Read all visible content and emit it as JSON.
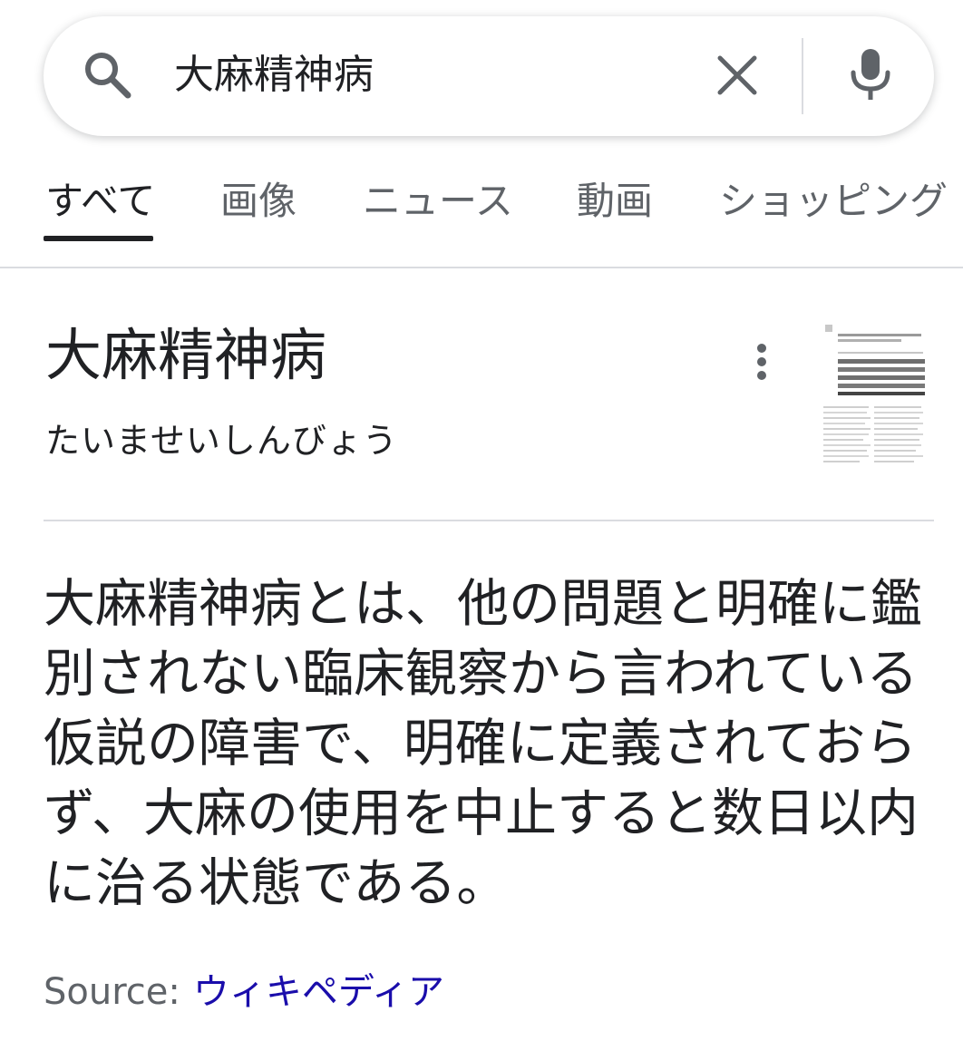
{
  "search": {
    "query": "大麻精神病",
    "search_icon": "search-icon",
    "clear_icon": "close-icon",
    "mic_icon": "microphone-icon"
  },
  "tabs": [
    {
      "label": "すべて",
      "active": true
    },
    {
      "label": "画像",
      "active": false
    },
    {
      "label": "ニュース",
      "active": false
    },
    {
      "label": "動画",
      "active": false
    },
    {
      "label": "ショッピング",
      "active": false
    }
  ],
  "knowledge_panel": {
    "title": "大麻精神病",
    "reading": "たいませいしんびょう",
    "more_icon": "more-vert-icon",
    "description": "大麻精神病とは、他の問題と明確に鑑別されない臨床観察から言われている仮説の障害で、明確に定義されておらず、大麻の使用を中止すると数日以内に治る状態である。",
    "source_label": "Source:",
    "source_link": "ウィキペディア"
  },
  "colors": {
    "text_primary": "#202124",
    "text_secondary": "#5f6368",
    "link": "#1a0dab",
    "divider": "#dadce0",
    "background": "#ffffff"
  }
}
